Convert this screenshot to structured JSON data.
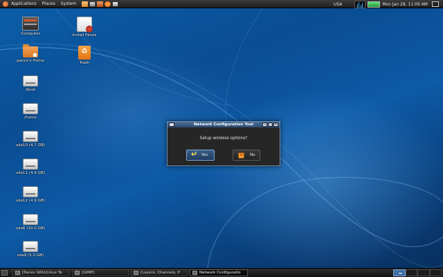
{
  "top_panel": {
    "menus": [
      "Applications",
      "Places",
      "System"
    ],
    "keyboard_layout": "USA",
    "battery_level_percent": 95,
    "clock": "Mon Jan 28, 11:09 AM"
  },
  "desktop_icons": [
    {
      "label": "Computer",
      "icon": "computer-icon"
    },
    {
      "label": "parsix's Home",
      "icon": "home-folder-icon"
    },
    {
      "label": "/boot",
      "icon": "drive-icon"
    },
    {
      "label": "/home",
      "icon": "drive-icon"
    },
    {
      "label": "sda10 (4.7 GB)",
      "icon": "drive-icon"
    },
    {
      "label": "sda11 (4.9 GB)",
      "icon": "drive-icon"
    },
    {
      "label": "sda12 (4.9 GB)",
      "icon": "drive-icon"
    },
    {
      "label": "sda6 (10.0 GB)",
      "icon": "drive-icon"
    },
    {
      "label": "sda9 (5.0 GB)",
      "icon": "drive-icon"
    },
    {
      "label": "Install Parsix",
      "icon": "installer-icon"
    },
    {
      "label": "Trash",
      "icon": "trash-icon"
    }
  ],
  "dialog": {
    "title": "Network Configuration Tool",
    "message": "Setup wireless options?",
    "yes_label": "Yes",
    "no_label": "No",
    "minimize_glyph": "–",
    "maximize_glyph": "□",
    "close_glyph": "✕"
  },
  "taskbar": {
    "tasks": [
      {
        "label": "[Parsix GNU/Linux Te",
        "active": false
      },
      {
        "label": "[GIMP]",
        "active": false
      },
      {
        "label": "[Layers, Channels, P",
        "active": false
      },
      {
        "label": "Network Configuratio",
        "active": true
      }
    ],
    "active_workspace": 1
  },
  "colors": {
    "accent": "#3e6ea5",
    "desktop": "#0b5ea8",
    "panel": "#1e1e1e"
  }
}
